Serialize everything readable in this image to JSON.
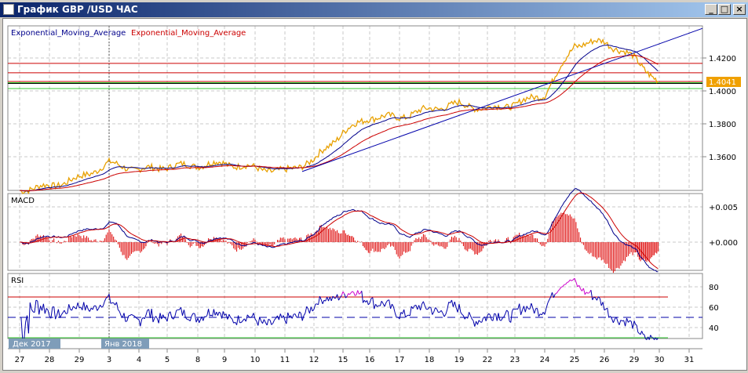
{
  "window": {
    "title": "График GBP /USD  ЧАС",
    "minimize": "_",
    "maximize": "□",
    "close": "×"
  },
  "legend": {
    "ema_blue": "Exponential_Moving_Average",
    "ema_red": "Exponential_Moving_Average"
  },
  "panels": {
    "macd_label": "MACD",
    "rsi_label": "RSI"
  },
  "current_price": "1.4041",
  "colors": {
    "price": "#e8a000",
    "ema_fast": "#00008b",
    "ema_slow": "#cc0000",
    "macd": "#00008b",
    "signal": "#cc0000",
    "hist": "#dd0000",
    "rsi": "#0000aa",
    "rsi_overbought": "#cc00cc",
    "level_red": "#cc0000",
    "level_green": "#33cc33",
    "trendline": "#0000aa"
  },
  "month_labels": [
    "Дек 2017",
    "Янв 2018"
  ],
  "chart_data": {
    "type": "line",
    "title": "GBP/USD hourly",
    "x_ticks": [
      "27",
      "28",
      "29",
      "3",
      "4",
      "5",
      "8",
      "9",
      "10",
      "11",
      "12",
      "15",
      "16",
      "17",
      "18",
      "19",
      "22",
      "23",
      "24",
      "25",
      "26",
      "29",
      "30",
      "31"
    ],
    "price_by_day": [
      1.34,
      1.342,
      1.347,
      1.356,
      1.352,
      1.354,
      1.355,
      1.356,
      1.353,
      1.351,
      1.358,
      1.375,
      1.384,
      1.384,
      1.389,
      1.392,
      1.389,
      1.392,
      1.398,
      1.428,
      1.43,
      1.42,
      1.405
    ],
    "price_axis": {
      "ticks": [
        "1.4200",
        "1.4000",
        "1.3800",
        "1.3600"
      ],
      "range": [
        1.3395,
        1.4395
      ]
    },
    "horizontal_levels": {
      "red": [
        1.4167,
        1.411,
        1.4057
      ],
      "green": [
        1.405,
        1.4014
      ],
      "black": 1.4045
    },
    "trendline": {
      "from_day": "11",
      "from_price": 1.351,
      "to_day": "31",
      "to_price": 1.438
    },
    "macd_axis": {
      "ticks": [
        "+0.005",
        "+0.000"
      ],
      "range": [
        -0.0025,
        0.007
      ]
    },
    "rsi_axis": {
      "ticks": [
        "80",
        "60",
        "40"
      ],
      "levels": [
        70,
        50,
        30
      ],
      "range": [
        28,
        100
      ]
    }
  }
}
